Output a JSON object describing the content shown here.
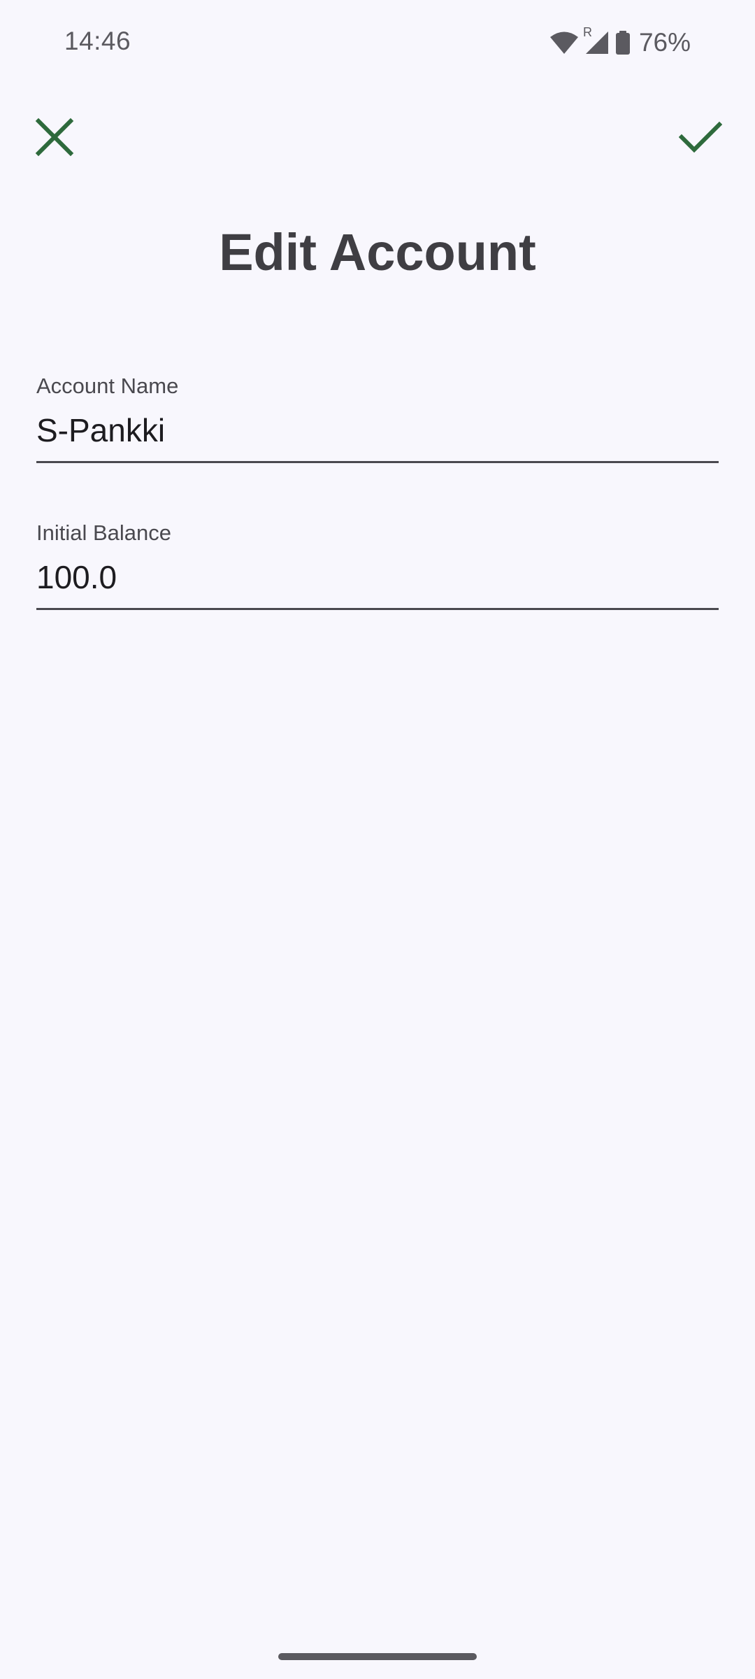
{
  "status_bar": {
    "time": "14:46",
    "roaming_indicator": "R",
    "battery_percent": "76%",
    "icons": [
      "wifi-icon",
      "signal-icon",
      "battery-icon"
    ]
  },
  "toolbar": {
    "close_icon": "close-icon",
    "save_icon": "check-icon",
    "accent_color": "#2e6a3c"
  },
  "page": {
    "title": "Edit Account"
  },
  "form": {
    "account_name": {
      "label": "Account Name",
      "value": "S-Pankki"
    },
    "initial_balance": {
      "label": "Initial Balance",
      "value": "100.0"
    }
  }
}
